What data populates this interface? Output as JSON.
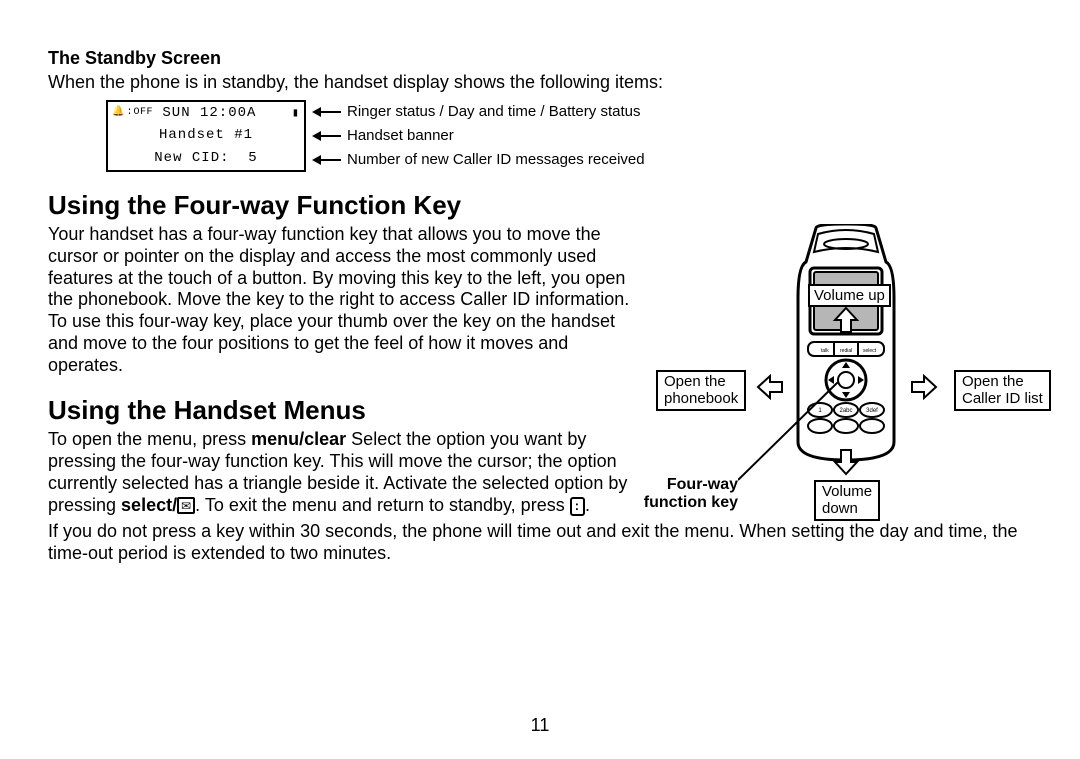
{
  "standby": {
    "title": "The Standby Screen",
    "intro": "When the phone is in standby, the handset display shows the following items:",
    "lcd": {
      "row1_bell_off": "OFF",
      "row1_daytime": "SUN 12:00A",
      "row2": "Handset #1",
      "row3": "New CID:  5"
    },
    "annot": {
      "row1": "Ringer status / Day and time / Battery status",
      "row2": "Handset banner",
      "row3": "Number of new Caller ID messages received"
    }
  },
  "fourway": {
    "title": "Using the Four-way Function Key",
    "para": "Your handset has a four-way function key that allows you to move the cursor or pointer on the display and access the most commonly used features at the touch of a button. By moving this key to the left, you open the phonebook. Move the key to the right to access Caller ID information. To use this four-way key, place your thumb over the key on the handset and move to the four positions to get the feel of how it moves and operates."
  },
  "menus": {
    "title": "Using the Handset Menus",
    "p1a": "To open the menu, press ",
    "p1_bold1": "menu/clear",
    "p1b": " Select the option you want by pressing the four-way function key. This will move the cursor; the option currently selected has a triangle beside it. Activate the selected option by pressing ",
    "p1_bold2": "select/",
    "p1c": ". To exit the menu and return to standby, press ",
    "p1d": ".",
    "p2": "If you do not press a key within 30 seconds, the phone will time out and exit the menu. When setting the day and time, the time-out period is extended to two minutes."
  },
  "diagram": {
    "volume_up": "Volume up",
    "volume_down_1": "Volume",
    "volume_down_2": "down",
    "open_phonebook_1": "Open the",
    "open_phonebook_2": "phonebook",
    "open_cid_1": "Open the",
    "open_cid_2": "Caller ID list",
    "fk_label_1": "Four-way",
    "fk_label_2": "function key"
  },
  "page_number": "11"
}
